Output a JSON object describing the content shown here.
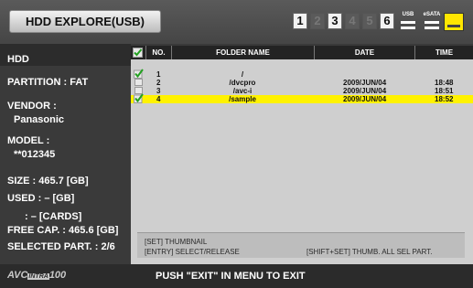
{
  "header": {
    "title": "HDD EXPLORE(USB)",
    "slots": [
      {
        "label": "1",
        "active": true
      },
      {
        "label": "2",
        "active": false
      },
      {
        "label": "3",
        "active": true
      },
      {
        "label": "4",
        "active": false
      },
      {
        "label": "5",
        "active": false
      },
      {
        "label": "6",
        "active": true
      }
    ],
    "usb_label": "USB",
    "esata_label": "eSATA",
    "icons": [
      "usb-icon",
      "esata-icon",
      "hdd-icon"
    ]
  },
  "left": {
    "heading": "HDD",
    "partition": "PARTITION : FAT",
    "vendor_label": "VENDOR :",
    "vendor_value": "Panasonic",
    "model_label": "MODEL :",
    "model_value": "**012345",
    "size": "SIZE : 465.7 [GB]",
    "used_gb": "USED : – [GB]",
    "used_cards": ": – [CARDS]",
    "free": "FREE CAP. : 465.6 [GB]",
    "selected_part": "SELECTED PART. : 2/6"
  },
  "table": {
    "columns": {
      "no": "NO.",
      "folder": "FOLDER NAME",
      "date": "DATE",
      "time": "TIME"
    },
    "rows": [
      {
        "checked": true,
        "no": "1",
        "folder": "/",
        "date": "",
        "time": "",
        "selected": false
      },
      {
        "checked": false,
        "no": "2",
        "folder": "/dvcpro",
        "date": "2009/JUN/04",
        "time": "18:48",
        "selected": false
      },
      {
        "checked": false,
        "no": "3",
        "folder": "/avc-i",
        "date": "2009/JUN/04",
        "time": "18:51",
        "selected": false
      },
      {
        "checked": true,
        "no": "4",
        "folder": "/sample",
        "date": "2009/JUN/04",
        "time": "18:52",
        "selected": true
      }
    ]
  },
  "info": {
    "line1": "[SET] THUMBNAIL",
    "line2_left": "[ENTRY] SELECT/RELEASE",
    "line2_right": "[SHIFT+SET] THUMB. ALL SEL PART."
  },
  "footer": {
    "logo_left": "AVC",
    "logo_mid": "INTRA",
    "logo_right": "100",
    "message": "PUSH \"EXIT\" IN MENU TO EXIT"
  },
  "colors": {
    "selected_row": "#fff200",
    "check_green": "#22a020",
    "panel": "#3a3a3a",
    "table_bg": "#cfcfcf"
  }
}
